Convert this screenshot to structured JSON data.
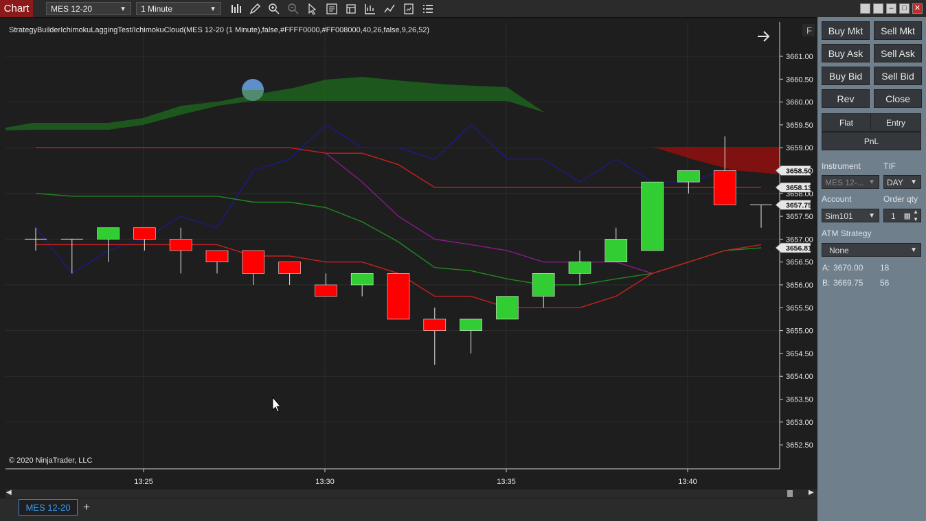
{
  "toolbar": {
    "chart_label": "Chart",
    "instrument": "MES 12-20",
    "interval": "1 Minute",
    "tool_icons": [
      "bars-icon",
      "pencil-icon",
      "zoom-in-icon",
      "zoom-out-icon",
      "pointer-icon",
      "data-box-icon",
      "properties-icon",
      "indicators-icon",
      "strategies-icon",
      "templates-icon",
      "menu-icon"
    ]
  },
  "chart": {
    "indicator_label": "StrategyBuilderIchimokuLaggingTest/IchimokuCloud(MES 12-20 (1 Minute),false,#FFFF0000,#FF008000,40,26,false,9,26,52)",
    "copyright": "© 2020 NinjaTrader, LLC",
    "f_button": "F",
    "y_ticks": [
      "3661.00",
      "3660.50",
      "3660.00",
      "3659.50",
      "3659.00",
      "3658.50",
      "3658.00",
      "3657.50",
      "3657.00",
      "3656.50",
      "3656.00",
      "3655.50",
      "3655.00",
      "3654.50",
      "3654.00",
      "3653.50",
      "3653.00",
      "3652.50"
    ],
    "x_ticks": [
      "13:25",
      "13:30",
      "13:35",
      "13:40"
    ],
    "price_flags": [
      {
        "label": "3658.50",
        "color": "#e6e6e6",
        "text_color": "#111"
      },
      {
        "label": "3658.13",
        "color": "#e6e6e6",
        "text_color": "#111"
      },
      {
        "label": "3657.75",
        "color": "#e6e6e6",
        "text_color": "#111"
      },
      {
        "label": "3656.81",
        "color": "#e6e6e6",
        "text_color": "#111"
      }
    ],
    "up_color": "#32cd32",
    "down_color": "#ff0000",
    "candles": [
      {
        "t": 0,
        "o": 3657.0,
        "h": 3657.25,
        "l": 3656.75,
        "c": 3657.0
      },
      {
        "t": 1,
        "o": 3657.0,
        "h": 3657.0,
        "l": 3656.25,
        "c": 3657.0
      },
      {
        "t": 2,
        "o": 3657.0,
        "h": 3657.25,
        "l": 3656.5,
        "c": 3657.25
      },
      {
        "t": 3,
        "o": 3657.25,
        "h": 3657.25,
        "l": 3656.75,
        "c": 3657.0
      },
      {
        "t": 4,
        "o": 3657.0,
        "h": 3657.25,
        "l": 3656.25,
        "c": 3656.75
      },
      {
        "t": 5,
        "o": 3656.75,
        "h": 3656.75,
        "l": 3656.25,
        "c": 3656.5
      },
      {
        "t": 6,
        "o": 3656.75,
        "h": 3656.75,
        "l": 3656.0,
        "c": 3656.25
      },
      {
        "t": 7,
        "o": 3656.5,
        "h": 3656.5,
        "l": 3656.0,
        "c": 3656.25
      },
      {
        "t": 8,
        "o": 3656.0,
        "h": 3656.25,
        "l": 3655.75,
        "c": 3655.75
      },
      {
        "t": 9,
        "o": 3656.0,
        "h": 3656.25,
        "l": 3655.75,
        "c": 3656.25
      },
      {
        "t": 10,
        "o": 3656.25,
        "h": 3656.25,
        "l": 3655.25,
        "c": 3655.25
      },
      {
        "t": 11,
        "o": 3655.25,
        "h": 3655.5,
        "l": 3654.25,
        "c": 3655.0
      },
      {
        "t": 12,
        "o": 3655.0,
        "h": 3655.25,
        "l": 3654.5,
        "c": 3655.25
      },
      {
        "t": 13,
        "o": 3655.25,
        "h": 3655.75,
        "l": 3655.25,
        "c": 3655.75
      },
      {
        "t": 14,
        "o": 3655.75,
        "h": 3656.25,
        "l": 3655.5,
        "c": 3656.25
      },
      {
        "t": 15,
        "o": 3656.25,
        "h": 3656.75,
        "l": 3656.0,
        "c": 3656.5
      },
      {
        "t": 16,
        "o": 3656.5,
        "h": 3657.25,
        "l": 3656.5,
        "c": 3657.0
      },
      {
        "t": 17,
        "o": 3656.75,
        "h": 3658.25,
        "l": 3656.75,
        "c": 3658.25
      },
      {
        "t": 18,
        "o": 3658.25,
        "h": 3658.5,
        "l": 3658.0,
        "c": 3658.5
      },
      {
        "t": 19,
        "o": 3658.5,
        "h": 3659.25,
        "l": 3657.75,
        "c": 3657.75
      },
      {
        "t": 20,
        "o": 3657.75,
        "h": 3657.75,
        "l": 3657.25,
        "c": 3657.75
      }
    ],
    "lines": [
      {
        "name": "tenkan",
        "color": "#1a1a8c",
        "points": [
          [
            0,
            3657.25
          ],
          [
            1,
            3656.25
          ],
          [
            2,
            3656.75
          ],
          [
            3,
            3657.0
          ],
          [
            4,
            3657.5
          ],
          [
            5,
            3657.25
          ],
          [
            6,
            3658.5
          ],
          [
            7,
            3658.75
          ],
          [
            8,
            3659.5
          ],
          [
            9,
            3659.0
          ],
          [
            10,
            3659.0
          ],
          [
            11,
            3658.75
          ],
          [
            12,
            3659.5
          ],
          [
            13,
            3658.75
          ],
          [
            14,
            3658.75
          ],
          [
            15,
            3658.25
          ],
          [
            16,
            3658.75
          ],
          [
            17,
            3658.25
          ],
          [
            18,
            3658.25
          ],
          [
            19,
            3658.5
          ]
        ]
      },
      {
        "name": "kijun",
        "color": "#cc1f1f",
        "points": [
          [
            0,
            3659.0
          ],
          [
            1,
            3659.0
          ],
          [
            2,
            3659.0
          ],
          [
            3,
            3659.0
          ],
          [
            4,
            3659.0
          ],
          [
            5,
            3659.0
          ],
          [
            6,
            3659.0
          ],
          [
            7,
            3659.0
          ],
          [
            8,
            3658.88
          ],
          [
            9,
            3658.88
          ],
          [
            10,
            3658.63
          ],
          [
            11,
            3658.13
          ],
          [
            12,
            3658.13
          ],
          [
            13,
            3658.13
          ],
          [
            14,
            3658.13
          ],
          [
            15,
            3658.13
          ],
          [
            16,
            3658.13
          ],
          [
            17,
            3658.13
          ],
          [
            18,
            3658.13
          ],
          [
            19,
            3658.13
          ],
          [
            20,
            3658.13
          ]
        ]
      },
      {
        "name": "lagging",
        "color": "#8b1a8b",
        "points": [
          [
            8,
            3658.88
          ],
          [
            9,
            3658.25
          ],
          [
            10,
            3657.5
          ],
          [
            11,
            3657.0
          ],
          [
            12,
            3656.88
          ],
          [
            13,
            3656.75
          ],
          [
            14,
            3656.5
          ],
          [
            15,
            3656.5
          ],
          [
            16,
            3656.5
          ],
          [
            17,
            3656.25
          ]
        ]
      },
      {
        "name": "senkou-a",
        "color": "#1f8a1f",
        "points": [
          [
            0,
            3658.0
          ],
          [
            1,
            3657.94
          ],
          [
            2,
            3657.94
          ],
          [
            3,
            3657.94
          ],
          [
            4,
            3657.94
          ],
          [
            5,
            3657.94
          ],
          [
            6,
            3657.81
          ],
          [
            7,
            3657.81
          ],
          [
            8,
            3657.69
          ],
          [
            9,
            3657.38
          ],
          [
            10,
            3656.94
          ],
          [
            11,
            3656.38
          ],
          [
            12,
            3656.31
          ],
          [
            13,
            3656.13
          ],
          [
            14,
            3656.0
          ],
          [
            15,
            3656.0
          ],
          [
            16,
            3656.13
          ],
          [
            17,
            3656.25
          ],
          [
            18,
            3656.5
          ],
          [
            19,
            3656.75
          ],
          [
            20,
            3656.81
          ]
        ]
      },
      {
        "name": "senkou-b",
        "color": "#cc1f1f",
        "points": [
          [
            0,
            3656.88
          ],
          [
            1,
            3656.88
          ],
          [
            2,
            3656.88
          ],
          [
            3,
            3656.88
          ],
          [
            4,
            3656.88
          ],
          [
            5,
            3656.88
          ],
          [
            6,
            3656.63
          ],
          [
            7,
            3656.63
          ],
          [
            8,
            3656.5
          ],
          [
            9,
            3656.5
          ],
          [
            10,
            3656.25
          ],
          [
            11,
            3655.75
          ],
          [
            12,
            3655.75
          ],
          [
            13,
            3655.5
          ],
          [
            14,
            3655.5
          ],
          [
            15,
            3655.5
          ],
          [
            16,
            3655.75
          ],
          [
            17,
            3656.25
          ],
          [
            18,
            3656.5
          ],
          [
            19,
            3656.75
          ],
          [
            20,
            3656.88
          ]
        ]
      }
    ]
  },
  "tabs": [
    {
      "label": "MES 12-20"
    }
  ],
  "panel": {
    "buttons": [
      "Buy Mkt",
      "Sell Mkt",
      "Buy Ask",
      "Sell Ask",
      "Buy Bid",
      "Sell Bid",
      "Rev",
      "Close"
    ],
    "grid": [
      "Flat",
      "Entry",
      "PnL"
    ],
    "instrument_label": "Instrument",
    "instrument_value": "MES 12-...",
    "tif_label": "TIF",
    "tif_value": "DAY",
    "account_label": "Account",
    "account_value": "Sim101",
    "qty_label": "Order qty",
    "qty_value": "1",
    "atm_label": "ATM Strategy",
    "atm_value": "None",
    "ask_label": "A:",
    "ask_price": "3670.00",
    "ask_size": "18",
    "bid_label": "B:",
    "bid_price": "3669.75",
    "bid_size": "56"
  }
}
